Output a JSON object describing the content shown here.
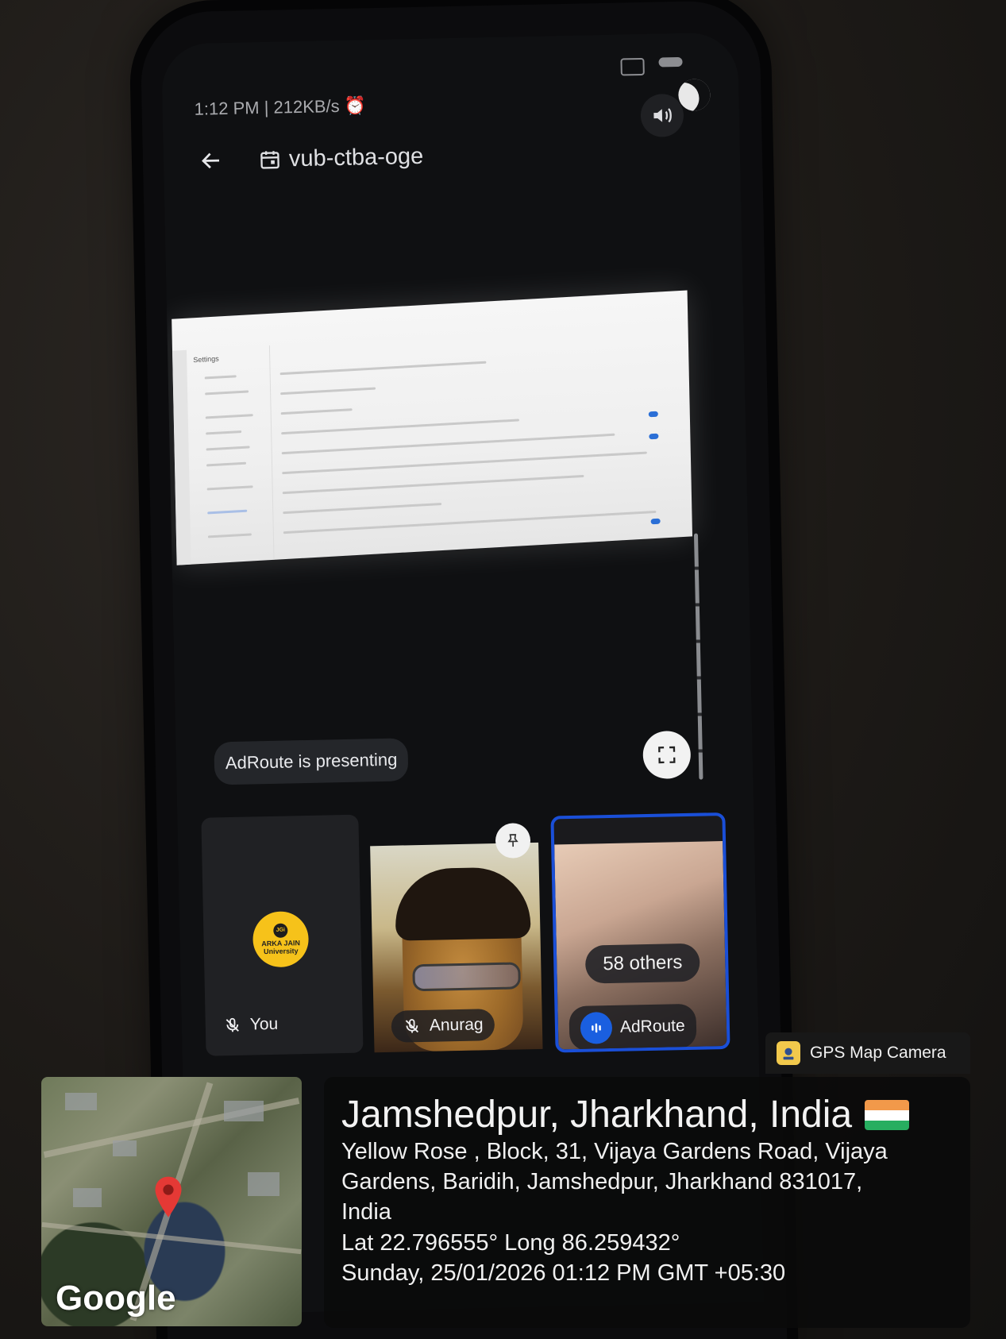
{
  "status_bar": {
    "time_speed": "1:12 PM | 212KB/s"
  },
  "meet": {
    "meeting_code": "vub-ctba-oge",
    "presenting_label": "AdRoute is presenting",
    "shared_screen_title": "Settings",
    "participants": [
      {
        "name": "You",
        "muted": true
      },
      {
        "name": "Anurag",
        "muted": true
      },
      {
        "name": "AdRoute",
        "muted": false
      }
    ],
    "others_label": "58 others",
    "you_logo_text": {
      "top": "JGi",
      "line1": "ARKA JAIN",
      "line2": "University"
    }
  },
  "gps": {
    "app_name": "GPS Map Camera",
    "city": "Jamshedpur, Jharkhand, India",
    "address_lines": [
      "Yellow Rose , Block, 31, Vijaya Gardens Road, Vijaya",
      "Gardens, Baridih, Jamshedpur, Jharkhand 831017,",
      "India"
    ],
    "latlong": "Lat 22.796555° Long 86.259432°",
    "datetime": "Sunday, 25/01/2026 01:12 PM GMT +05:30",
    "map_brand": "Google"
  },
  "colors": {
    "highlight_border": "#1a4fd8",
    "gps_icon": "#f2c94c",
    "flag_saffron": "#f2994a",
    "flag_white": "#ffffff",
    "flag_green": "#27ae60"
  }
}
